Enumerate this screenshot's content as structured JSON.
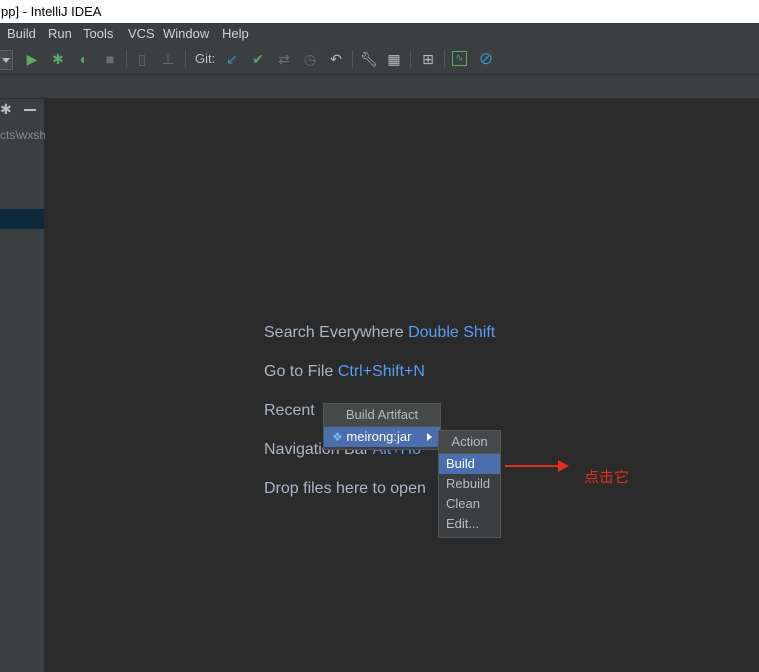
{
  "window": {
    "title": "pp] - IntelliJ IDEA"
  },
  "menu": {
    "items": [
      "Build",
      "Run",
      "Tools",
      "VCS",
      "Window",
      "Help"
    ]
  },
  "toolbar": {
    "git_label": "Git:"
  },
  "left_panel": {
    "path_text": "cts\\wxsh"
  },
  "editor": {
    "hints": [
      {
        "label": "Search Everywhere",
        "key": "Double Shift"
      },
      {
        "label": "Go to File",
        "key": "Ctrl+Shift+N"
      },
      {
        "label": "Recent",
        "key": ""
      },
      {
        "label": "Navigation Bar",
        "key": "Alt+Ho"
      },
      {
        "label": "Drop files here to open",
        "key": ""
      }
    ]
  },
  "build_artifact_popup": {
    "title": "Build Artifact",
    "artifact": "meirong:jar"
  },
  "action_popup": {
    "title": "Action",
    "items": [
      "Build",
      "Rebuild",
      "Clean",
      "Edit..."
    ],
    "selected": "Build"
  },
  "annotation": {
    "text": "点击它",
    "color": "#e0301e"
  }
}
